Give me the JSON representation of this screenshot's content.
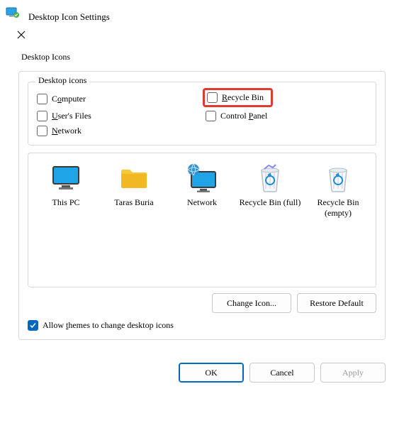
{
  "window": {
    "title": "Desktop Icon Settings"
  },
  "tab": {
    "label": "Desktop Icons"
  },
  "group": {
    "title": "Desktop icons",
    "items": {
      "computer": {
        "label_pre": "C",
        "label_ul": "o",
        "label_post": "mputer",
        "checked": false
      },
      "recycle": {
        "label_pre": "",
        "label_ul": "R",
        "label_post": "ecycle Bin",
        "checked": false,
        "highlighted": true
      },
      "users": {
        "label_pre": "",
        "label_ul": "U",
        "label_post": "ser's Files",
        "checked": false
      },
      "cpanel": {
        "label_pre": "Control ",
        "label_ul": "P",
        "label_post": "anel",
        "checked": false
      },
      "network": {
        "label_pre": "",
        "label_ul": "N",
        "label_post": "etwork",
        "checked": false
      }
    }
  },
  "icons": [
    {
      "name": "this-pc",
      "label": "This PC"
    },
    {
      "name": "user-folder",
      "label": "Taras Buria"
    },
    {
      "name": "network",
      "label": "Network"
    },
    {
      "name": "recycle-full",
      "label": "Recycle Bin (full)"
    },
    {
      "name": "recycle-empty",
      "label": "Recycle Bin (empty)"
    }
  ],
  "buttons": {
    "change_icon": "Change Icon...",
    "restore_default": "Restore Default",
    "ok": "OK",
    "cancel": "Cancel",
    "apply": "Apply"
  },
  "allow_themes": {
    "label_pre": "Allow ",
    "label_ul": "t",
    "label_post": "hemes to change desktop icons",
    "checked": true
  }
}
